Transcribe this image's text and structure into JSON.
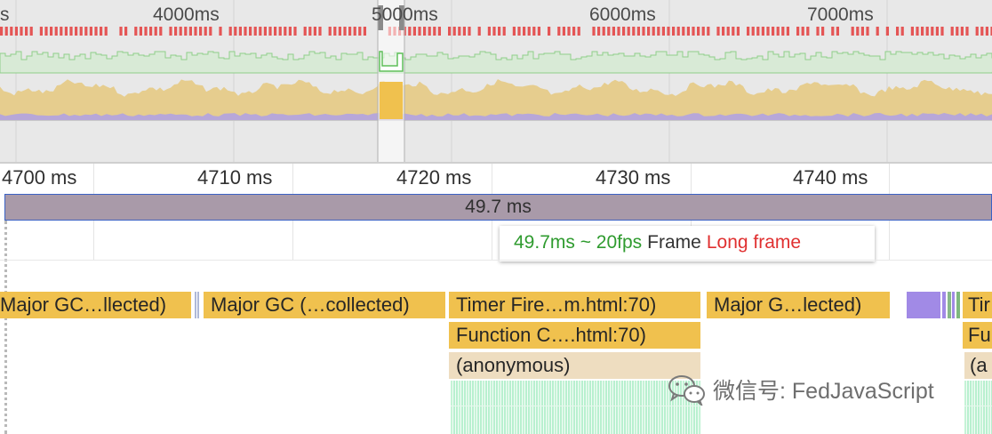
{
  "overview": {
    "tick_labels": [
      "s",
      "4000ms",
      "5000ms",
      "6000ms",
      "7000ms"
    ],
    "selection_label": "5000ms"
  },
  "ruler": {
    "labels": [
      "4700 ms",
      "4710 ms",
      "4720 ms",
      "4730 ms",
      "4740 ms"
    ]
  },
  "frame": {
    "duration_label": "49.7 ms"
  },
  "tooltip": {
    "fps": "49.7ms ~ 20fps",
    "frame": "Frame",
    "long_frame": "Long frame"
  },
  "flame": {
    "row1": [
      "Major GC…llected)",
      "Major GC (…collected)",
      "Timer Fire…m.html:70)",
      "Major G…lected)",
      "Tir"
    ],
    "row2": [
      "Function C….html:70)",
      "Fu"
    ],
    "row3": [
      "(anonymous)",
      "(a"
    ]
  },
  "watermark": {
    "text": "微信号: FedJavaScript",
    "icon": "wechat-icon"
  },
  "colors": {
    "event_yellow": "#f0c14e",
    "anonymous_tan": "#eeddc0",
    "frame_purple": "#a99aa9",
    "selection_blue": "#3b62c4",
    "fps_green": "#2f9b2f",
    "long_frame_red": "#e03030",
    "script_green": "#b8f0cf",
    "gc_purple": "#a18ae6"
  }
}
